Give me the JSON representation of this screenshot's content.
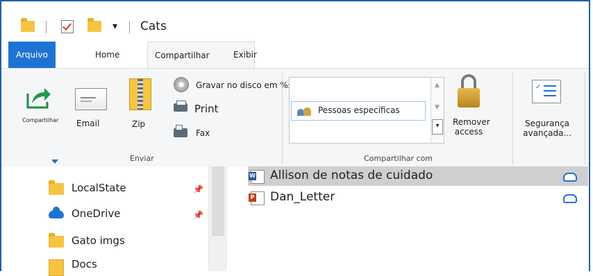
{
  "window": {
    "title": "Cats"
  },
  "tabs": [
    {
      "label": "Arquivo"
    },
    {
      "label": "Home"
    },
    {
      "label": "Compartilhar"
    },
    {
      "label": "Exibir"
    }
  ],
  "ribbon": {
    "send_group": {
      "label": "Enviar",
      "share_label": "Compartilhar",
      "email_label": "Email",
      "zip_label": "Zip",
      "burn_label": "Gravar no disco em %s",
      "print_label": "Print",
      "fax_label": "Fax"
    },
    "share_with_group": {
      "label": "Compartilhar com",
      "item_label": "Pessoas específicas",
      "remove_line1": "Remover",
      "remove_line2": "access"
    },
    "security": {
      "line1": "Segurança",
      "line2": "avançada..."
    }
  },
  "nav": {
    "items": [
      {
        "label": "LocalState",
        "pinned": true
      },
      {
        "label": "OneDrive",
        "pinned": true
      },
      {
        "label": "Gato imgs",
        "pinned": false
      },
      {
        "label": "Docs",
        "pinned": false
      }
    ]
  },
  "files": [
    {
      "name": "Allison de notas de cuidado",
      "type": "word",
      "selected": true
    },
    {
      "name": "Dan_Letter",
      "type": "powerpoint",
      "selected": false
    }
  ],
  "colors": {
    "accent": "#1e73d2",
    "folder": "#f5c542",
    "selected_row": "#cfcfcf"
  }
}
